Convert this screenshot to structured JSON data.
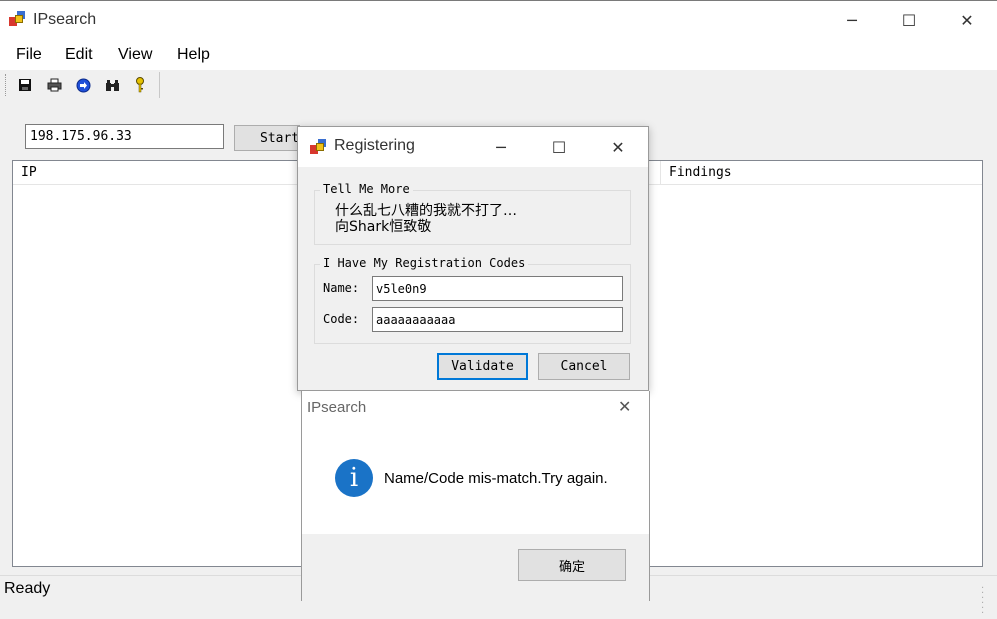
{
  "window": {
    "title": "IPsearch",
    "minimize_glyph": "─",
    "maximize_glyph": "☐",
    "close_glyph": "✕"
  },
  "menu": [
    "File",
    "Edit",
    "View",
    "Help"
  ],
  "toolbar": {
    "icons": [
      "save-icon",
      "print-icon",
      "refresh-icon",
      "binoculars-icon",
      "key-icon"
    ]
  },
  "search": {
    "ip_value": "198.175.96.33",
    "start_label": "Start"
  },
  "list": {
    "columns": [
      "IP",
      "Findings"
    ]
  },
  "status": {
    "text": "Ready"
  },
  "register_dialog": {
    "title": "Registering",
    "group1_title": "Tell Me More",
    "message_line1": "什么乱七八糟的我就不打了…",
    "message_line2": "向Shark恒致敬",
    "group2_title": "I Have My Registration Codes",
    "name_label": "Name:",
    "name_value": "v5le0n9",
    "code_label": "Code:",
    "code_value": "aaaaaaaaaaa",
    "validate_label": "Validate",
    "cancel_label": "Cancel"
  },
  "message_box": {
    "title": "IPsearch",
    "text": "Name/Code mis-match.Try again.",
    "ok_label": "确定",
    "info_glyph": "i"
  },
  "colors": {
    "accent": "#0078d7",
    "info_icon": "#1a73c7"
  }
}
